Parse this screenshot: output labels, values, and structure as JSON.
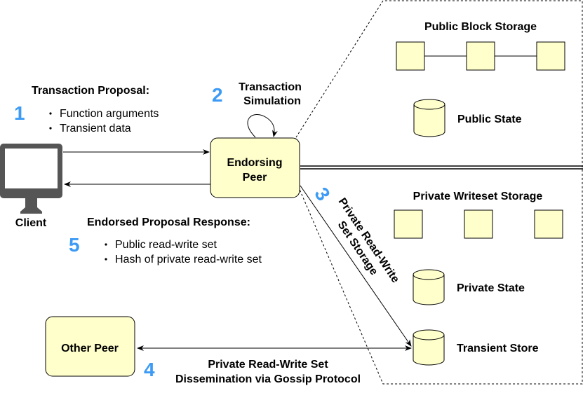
{
  "colors": {
    "box_fill": "#ffffcc",
    "step_number": "#3d9bf5",
    "client_icon": "#555555"
  },
  "client": {
    "label": "Client",
    "icon": "desktop-monitor-icon"
  },
  "endorsing_peer": {
    "label_line1": "Endorsing",
    "label_line2": "Peer"
  },
  "other_peer": {
    "label": "Other Peer"
  },
  "step1": {
    "number": "1",
    "title": "Transaction Proposal:",
    "bullets": [
      "Function arguments",
      "Transient data"
    ]
  },
  "step2": {
    "number": "2",
    "line1": "Transaction",
    "line2": "Simulation"
  },
  "step3": {
    "number": "3",
    "line1": "Private Read-Write",
    "line2": "Set Storage"
  },
  "step4": {
    "number": "4",
    "line1": "Private Read-Write Set",
    "line2": "Dissemination via Gossip Protocol"
  },
  "step5": {
    "number": "5",
    "title": "Endorsed Proposal Response:",
    "bullets": [
      "Public read-write set",
      "Hash of private read-write set"
    ]
  },
  "public_panel": {
    "block_storage": "Public Block Storage",
    "state": "Public State"
  },
  "private_panel": {
    "writeset_storage": "Private Writeset Storage",
    "state": "Private State",
    "transient": "Transient Store"
  }
}
